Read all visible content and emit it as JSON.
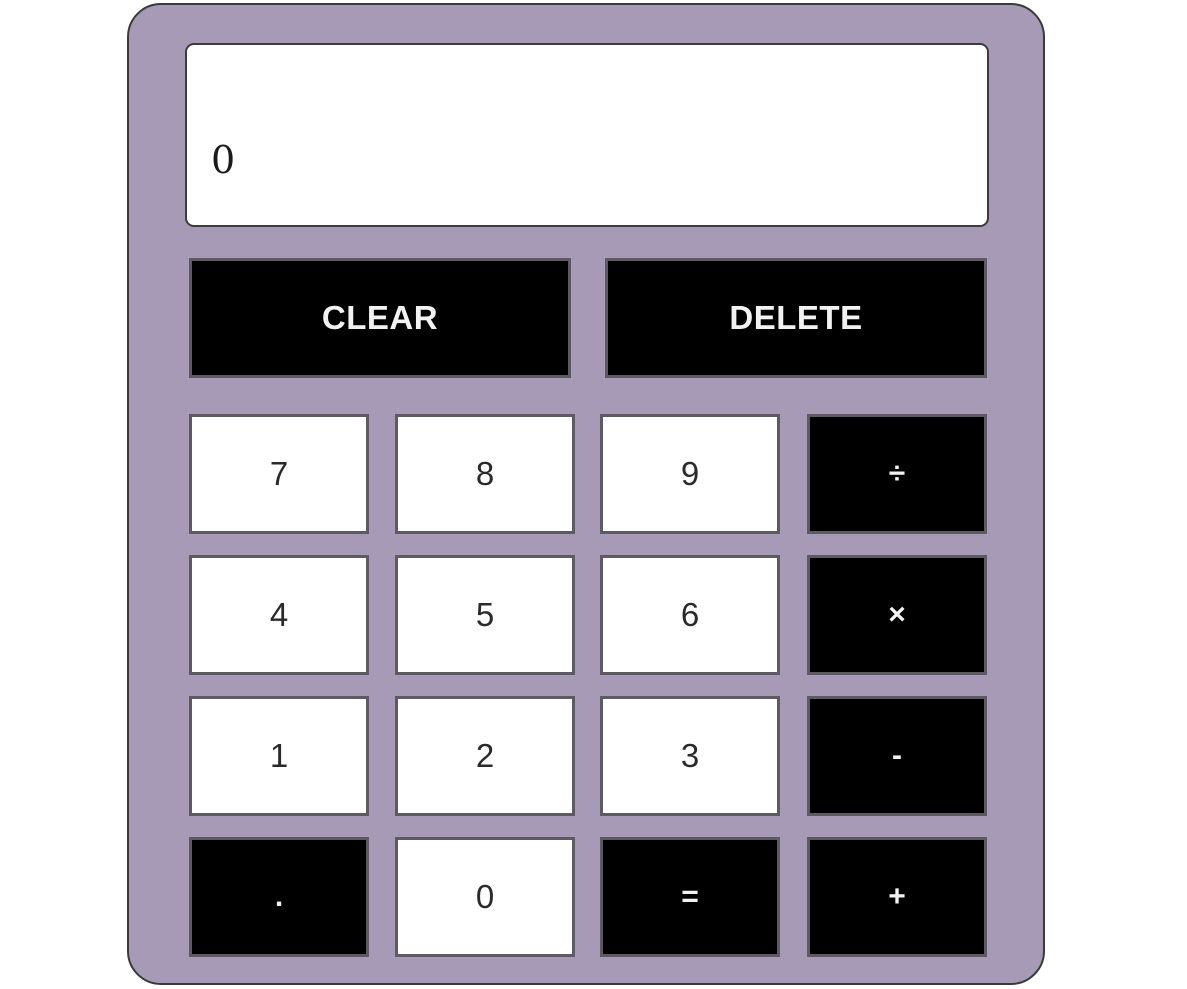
{
  "display": {
    "value": "0"
  },
  "actions": {
    "clear_label": "CLEAR",
    "delete_label": "DELETE"
  },
  "keys": {
    "seven": "7",
    "eight": "8",
    "nine": "9",
    "divide": "÷",
    "four": "4",
    "five": "5",
    "six": "6",
    "multiply": "×",
    "one": "1",
    "two": "2",
    "three": "3",
    "subtract": "-",
    "decimal": ".",
    "zero": "0",
    "equals": "=",
    "add": "+"
  },
  "colors": {
    "body": "#a69ab6",
    "display_bg": "#ffffff",
    "operator_key": "#000000",
    "number_key": "#ffffff"
  }
}
